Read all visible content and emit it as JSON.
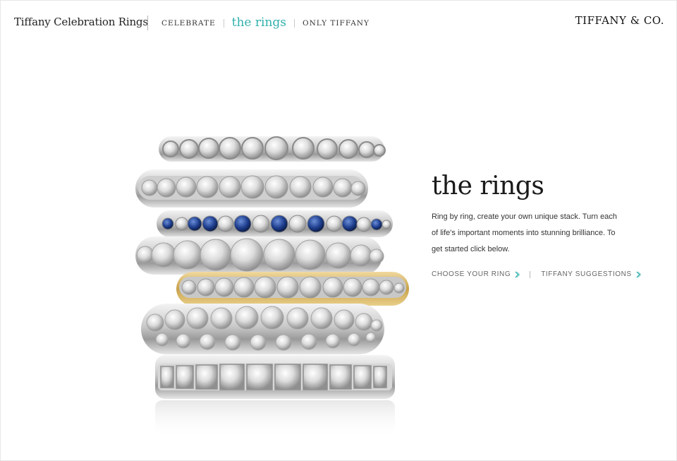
{
  "header": {
    "site_title": "Tiffany Celebration Rings",
    "nav": {
      "celebrate": "CELEBRATE",
      "the_rings": "the rings",
      "only_tiffany": "ONLY TIFFANY"
    },
    "brand": "TIFFANY & CO."
  },
  "intro": {
    "title": "the rings",
    "body": "Ring by ring, create your own unique stack. Turn each of life's important moments into stunning brilliance. To get started click below."
  },
  "actions": {
    "choose_ring": "CHOOSE YOUR RING",
    "suggestions": "TIFFANY SUGGESTIONS"
  },
  "colors": {
    "accent": "#31b1ad",
    "text": "#333333",
    "gold": "#c9a24a",
    "sapphire": "#1f3f8f"
  }
}
